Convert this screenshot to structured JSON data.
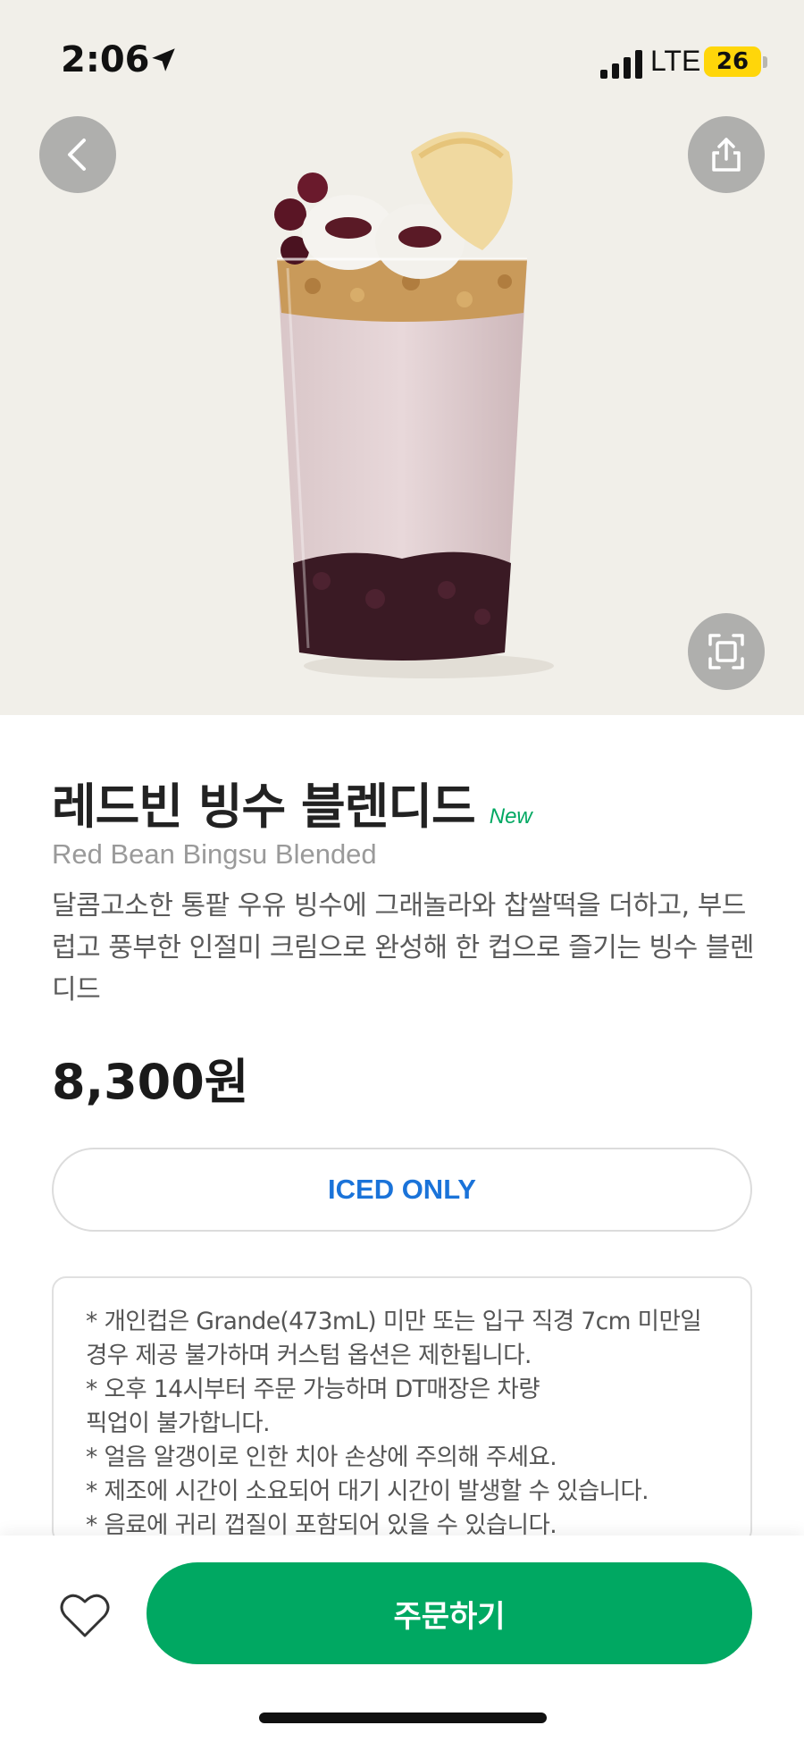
{
  "status_bar": {
    "time": "2:06",
    "network": "LTE",
    "battery": "26",
    "icons": [
      "location-arrow-icon",
      "signal-bars-icon"
    ]
  },
  "product": {
    "name_ko": "레드빈 빙수 블렌디드",
    "badge": "New",
    "name_en": "Red Bean Bingsu Blended",
    "description": "달콤고소한 통팥 우유 빙수에 그래놀라와 찹쌀떡을 더하고, 부드럽고 풍부한 인절미 크림으로 완성해 한 컵으로 즐기는 빙수 블렌디드",
    "price": "8,300원",
    "temperature_option": "ICED ONLY",
    "notices": [
      "* 개인컵은 Grande(473mL) 미만 또는 입구 직경 7cm 미만일",
      "경우 제공 불가하며 커스텀 옵션은 제한됩니다.",
      "* 오후 14시부터 주문 가능하며 DT매장은 차량",
      "픽업이 불가합니다.",
      "* 얼음 알갱이로 인한 치아 손상에 주의해 주세요.",
      "* 제조에 시간이 소요되어 대기 시간이 발생할 수 있습니다.",
      "* 음료에 귀리 껍질이 포함되어 있을 수 있습니다."
    ]
  },
  "actions": {
    "order_label": "주문하기",
    "favorite_icon": "heart-outline-icon",
    "back_icon": "chevron-left-icon",
    "share_icon": "share-icon",
    "zoom_icon": "expand-icon"
  },
  "colors": {
    "accent": "#00a862",
    "iced_text": "#1a73d9",
    "hero_bg": "#f1efe9",
    "battery": "#ffd60a"
  }
}
